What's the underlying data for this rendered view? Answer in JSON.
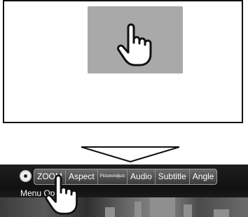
{
  "menu": {
    "items": [
      {
        "label": "ZOOM"
      },
      {
        "label": "Aspect"
      },
      {
        "label": "PictureAdjust"
      },
      {
        "label": "Audio"
      },
      {
        "label": "Subtitle"
      },
      {
        "label": "Angle"
      }
    ],
    "menu_label": "Menu Ope"
  },
  "icons": {
    "tap_hand_upper": "pointing-hand-icon",
    "tap_hand_lower": "pointing-hand-icon",
    "disc": "disc-icon",
    "arrow": "down-arrow-icon"
  },
  "colors": {
    "touch_zone": "#a9a9a9",
    "menu_bar": "#4a4a4a",
    "screen_border": "#111111"
  }
}
